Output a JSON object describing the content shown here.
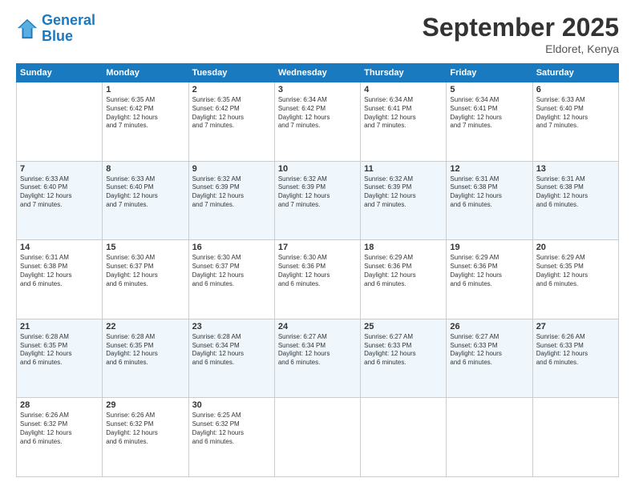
{
  "header": {
    "logo_line1": "General",
    "logo_line2": "Blue",
    "month": "September 2025",
    "location": "Eldoret, Kenya"
  },
  "days_of_week": [
    "Sunday",
    "Monday",
    "Tuesday",
    "Wednesday",
    "Thursday",
    "Friday",
    "Saturday"
  ],
  "weeks": [
    [
      {
        "num": "",
        "info": ""
      },
      {
        "num": "1",
        "info": "Sunrise: 6:35 AM\nSunset: 6:42 PM\nDaylight: 12 hours\nand 7 minutes."
      },
      {
        "num": "2",
        "info": "Sunrise: 6:35 AM\nSunset: 6:42 PM\nDaylight: 12 hours\nand 7 minutes."
      },
      {
        "num": "3",
        "info": "Sunrise: 6:34 AM\nSunset: 6:42 PM\nDaylight: 12 hours\nand 7 minutes."
      },
      {
        "num": "4",
        "info": "Sunrise: 6:34 AM\nSunset: 6:41 PM\nDaylight: 12 hours\nand 7 minutes."
      },
      {
        "num": "5",
        "info": "Sunrise: 6:34 AM\nSunset: 6:41 PM\nDaylight: 12 hours\nand 7 minutes."
      },
      {
        "num": "6",
        "info": "Sunrise: 6:33 AM\nSunset: 6:40 PM\nDaylight: 12 hours\nand 7 minutes."
      }
    ],
    [
      {
        "num": "7",
        "info": "Sunrise: 6:33 AM\nSunset: 6:40 PM\nDaylight: 12 hours\nand 7 minutes."
      },
      {
        "num": "8",
        "info": "Sunrise: 6:33 AM\nSunset: 6:40 PM\nDaylight: 12 hours\nand 7 minutes."
      },
      {
        "num": "9",
        "info": "Sunrise: 6:32 AM\nSunset: 6:39 PM\nDaylight: 12 hours\nand 7 minutes."
      },
      {
        "num": "10",
        "info": "Sunrise: 6:32 AM\nSunset: 6:39 PM\nDaylight: 12 hours\nand 7 minutes."
      },
      {
        "num": "11",
        "info": "Sunrise: 6:32 AM\nSunset: 6:39 PM\nDaylight: 12 hours\nand 7 minutes."
      },
      {
        "num": "12",
        "info": "Sunrise: 6:31 AM\nSunset: 6:38 PM\nDaylight: 12 hours\nand 6 minutes."
      },
      {
        "num": "13",
        "info": "Sunrise: 6:31 AM\nSunset: 6:38 PM\nDaylight: 12 hours\nand 6 minutes."
      }
    ],
    [
      {
        "num": "14",
        "info": "Sunrise: 6:31 AM\nSunset: 6:38 PM\nDaylight: 12 hours\nand 6 minutes."
      },
      {
        "num": "15",
        "info": "Sunrise: 6:30 AM\nSunset: 6:37 PM\nDaylight: 12 hours\nand 6 minutes."
      },
      {
        "num": "16",
        "info": "Sunrise: 6:30 AM\nSunset: 6:37 PM\nDaylight: 12 hours\nand 6 minutes."
      },
      {
        "num": "17",
        "info": "Sunrise: 6:30 AM\nSunset: 6:36 PM\nDaylight: 12 hours\nand 6 minutes."
      },
      {
        "num": "18",
        "info": "Sunrise: 6:29 AM\nSunset: 6:36 PM\nDaylight: 12 hours\nand 6 minutes."
      },
      {
        "num": "19",
        "info": "Sunrise: 6:29 AM\nSunset: 6:36 PM\nDaylight: 12 hours\nand 6 minutes."
      },
      {
        "num": "20",
        "info": "Sunrise: 6:29 AM\nSunset: 6:35 PM\nDaylight: 12 hours\nand 6 minutes."
      }
    ],
    [
      {
        "num": "21",
        "info": "Sunrise: 6:28 AM\nSunset: 6:35 PM\nDaylight: 12 hours\nand 6 minutes."
      },
      {
        "num": "22",
        "info": "Sunrise: 6:28 AM\nSunset: 6:35 PM\nDaylight: 12 hours\nand 6 minutes."
      },
      {
        "num": "23",
        "info": "Sunrise: 6:28 AM\nSunset: 6:34 PM\nDaylight: 12 hours\nand 6 minutes."
      },
      {
        "num": "24",
        "info": "Sunrise: 6:27 AM\nSunset: 6:34 PM\nDaylight: 12 hours\nand 6 minutes."
      },
      {
        "num": "25",
        "info": "Sunrise: 6:27 AM\nSunset: 6:33 PM\nDaylight: 12 hours\nand 6 minutes."
      },
      {
        "num": "26",
        "info": "Sunrise: 6:27 AM\nSunset: 6:33 PM\nDaylight: 12 hours\nand 6 minutes."
      },
      {
        "num": "27",
        "info": "Sunrise: 6:26 AM\nSunset: 6:33 PM\nDaylight: 12 hours\nand 6 minutes."
      }
    ],
    [
      {
        "num": "28",
        "info": "Sunrise: 6:26 AM\nSunset: 6:32 PM\nDaylight: 12 hours\nand 6 minutes."
      },
      {
        "num": "29",
        "info": "Sunrise: 6:26 AM\nSunset: 6:32 PM\nDaylight: 12 hours\nand 6 minutes."
      },
      {
        "num": "30",
        "info": "Sunrise: 6:25 AM\nSunset: 6:32 PM\nDaylight: 12 hours\nand 6 minutes."
      },
      {
        "num": "",
        "info": ""
      },
      {
        "num": "",
        "info": ""
      },
      {
        "num": "",
        "info": ""
      },
      {
        "num": "",
        "info": ""
      }
    ]
  ]
}
